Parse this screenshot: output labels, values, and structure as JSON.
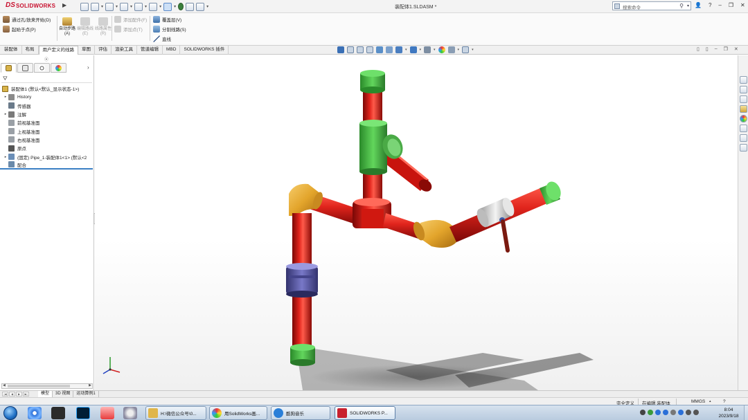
{
  "app": {
    "brand_ds": "DS",
    "brand_name": "SOLIDWORKS",
    "document_title": "装配体1.SLDASM *",
    "search_placeholder": "搜索命令"
  },
  "toolbar": {
    "route_through_clamp": "通过孔/放来开始(D)",
    "start_at_point": "起始于点(P)",
    "auto_route": "自动步路(A)",
    "edit_route": "编辑路线(E)",
    "route_properties": "线路属性(R)",
    "add_fitting": "添加配件(F)",
    "add_to_route": "添加点(T)",
    "cover_layer": "覆盖层(V)",
    "split_route": "分割线路(S)",
    "straight": "直线"
  },
  "tabs": [
    "装配体",
    "布局",
    "用户定义的线路",
    "草图",
    "评估",
    "渲染工具",
    "管道编辑",
    "MBD",
    "SOLIDWORKS 插件"
  ],
  "active_tab_index": 2,
  "feature_tree": {
    "root": "装配体1  (默认<默认_显示状态-1>)",
    "items": [
      {
        "label": "History",
        "expandable": true,
        "icon_color": "#8a8a8a",
        "indent": "child"
      },
      {
        "label": "传感器",
        "expandable": false,
        "icon_color": "#6a7a8a",
        "indent": "leaf"
      },
      {
        "label": "注解",
        "expandable": true,
        "icon_color": "#7a7a7a",
        "indent": "child"
      },
      {
        "label": "前视基准面",
        "expandable": false,
        "icon_color": "#9aa0a6",
        "indent": "leaf"
      },
      {
        "label": "上视基准面",
        "expandable": false,
        "icon_color": "#9aa0a6",
        "indent": "leaf"
      },
      {
        "label": "右视基准面",
        "expandable": false,
        "icon_color": "#9aa0a6",
        "indent": "leaf"
      },
      {
        "label": "原点",
        "expandable": false,
        "icon_color": "#555555",
        "indent": "leaf"
      },
      {
        "label": "(固定) Pipe_1-装配体1<1> (默认<2",
        "expandable": true,
        "icon_color": "#6b8fb8",
        "indent": "child"
      },
      {
        "label": "配合",
        "expandable": false,
        "icon_color": "#6a8aaa",
        "indent": "leaf"
      }
    ]
  },
  "bottom_tabs": [
    "模型",
    "3D 视图",
    "运动算例1"
  ],
  "active_bottom_tab": 0,
  "status": {
    "fully_defined": "完全定义",
    "editing": "在编辑 装配体",
    "units": "MMGS",
    "edit_mode": "在编辑"
  },
  "taskbar": {
    "windows": [
      {
        "label": "H:\\微信公众号\\0...",
        "icon_color": "#e0b64a"
      },
      {
        "label": "用SolidWorks画...",
        "icon_color": "#e04a3a"
      },
      {
        "label": "酷狗音乐",
        "icon_color": "#2a7fd8"
      },
      {
        "label": "SOLIDWORKS P...",
        "icon_color": "#c8202e"
      }
    ],
    "active_window_index": 3,
    "time": "8:04",
    "date": "2023/9/18"
  },
  "colors": {
    "pipe_red": "#d9140e",
    "elbow_orange": "#e3a52c",
    "cap_green": "#37c43a",
    "tee_green": "#5fbf5f",
    "union_blue": "#5a5aa8",
    "valve_silver": "#d6d6d6"
  }
}
